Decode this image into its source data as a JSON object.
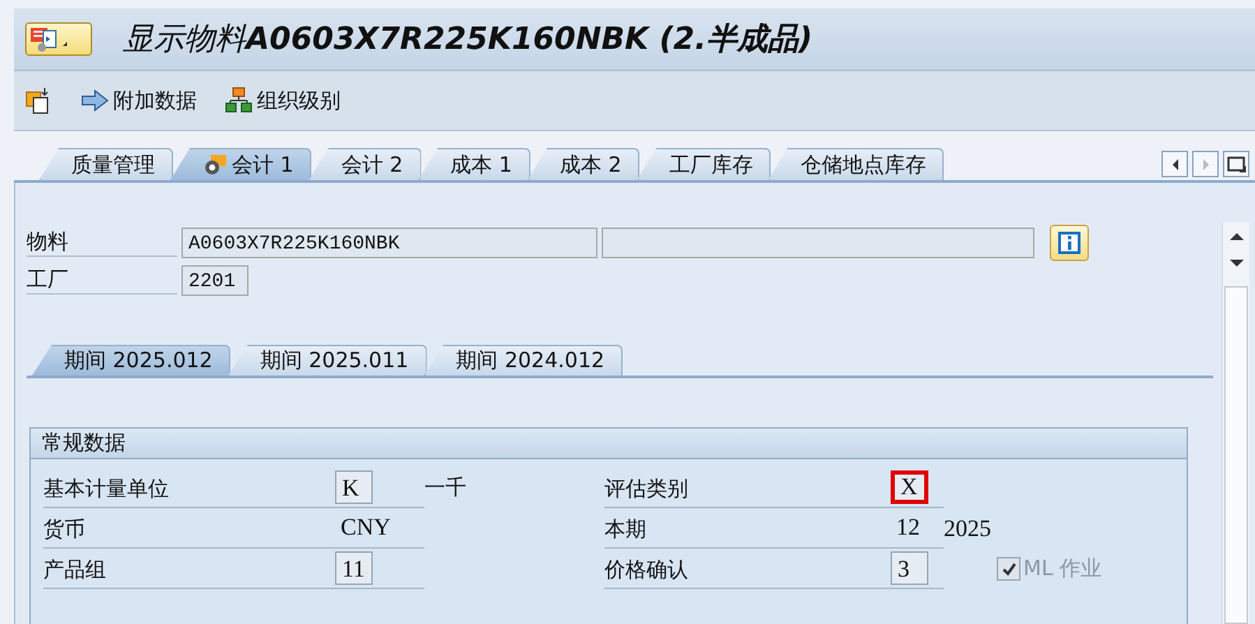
{
  "title": "显示物料**A0603X7R225K160NBK (2.半成品)**",
  "toolbar": [
    {
      "kind": "copy"
    },
    {
      "kind": "arrow",
      "label": "附加数据"
    },
    {
      "kind": "org",
      "label": "组织级别"
    }
  ],
  "tabs": [
    {
      "label": "质量管理",
      "selected": false
    },
    {
      "label": "会计 1",
      "selected": true
    },
    {
      "label": "会计 2",
      "selected": false
    },
    {
      "label": "成本 1",
      "selected": false
    },
    {
      "label": "成本 2",
      "selected": false
    },
    {
      "label": "工厂库存",
      "selected": false
    },
    {
      "label": "仓储地点库存",
      "selected": false
    }
  ],
  "header": {
    "material_label": "物料",
    "material": "A0603X7R225K160NBK",
    "plant_label": "工厂",
    "plant": "2201"
  },
  "period_tabs": [
    {
      "label": "期间 2025.012",
      "selected": true
    },
    {
      "label": "期间 2025.011",
      "selected": false
    },
    {
      "label": "期间 2024.012",
      "selected": false
    }
  ],
  "group": {
    "title": "常规数据",
    "fields": [
      {
        "label": "基本计量单位",
        "value": "K",
        "kind": "input",
        "highlighted": false,
        "extra": "一千"
      },
      {
        "label": "评估类别",
        "value": "X",
        "kind": "input",
        "highlighted": true
      },
      {
        "label": "货币",
        "value": "CNY",
        "kind": "plain"
      },
      {
        "label": "本期",
        "value": "12",
        "kind": "plain",
        "extra": "2025"
      },
      {
        "label": "产品组",
        "value": "11",
        "kind": "input",
        "highlighted": false
      },
      {
        "label": "价格确认",
        "value": "3",
        "kind": "input",
        "highlighted": false,
        "checkbox": {
          "label": "ML 作业",
          "checked": true,
          "disabled": true
        }
      }
    ]
  }
}
